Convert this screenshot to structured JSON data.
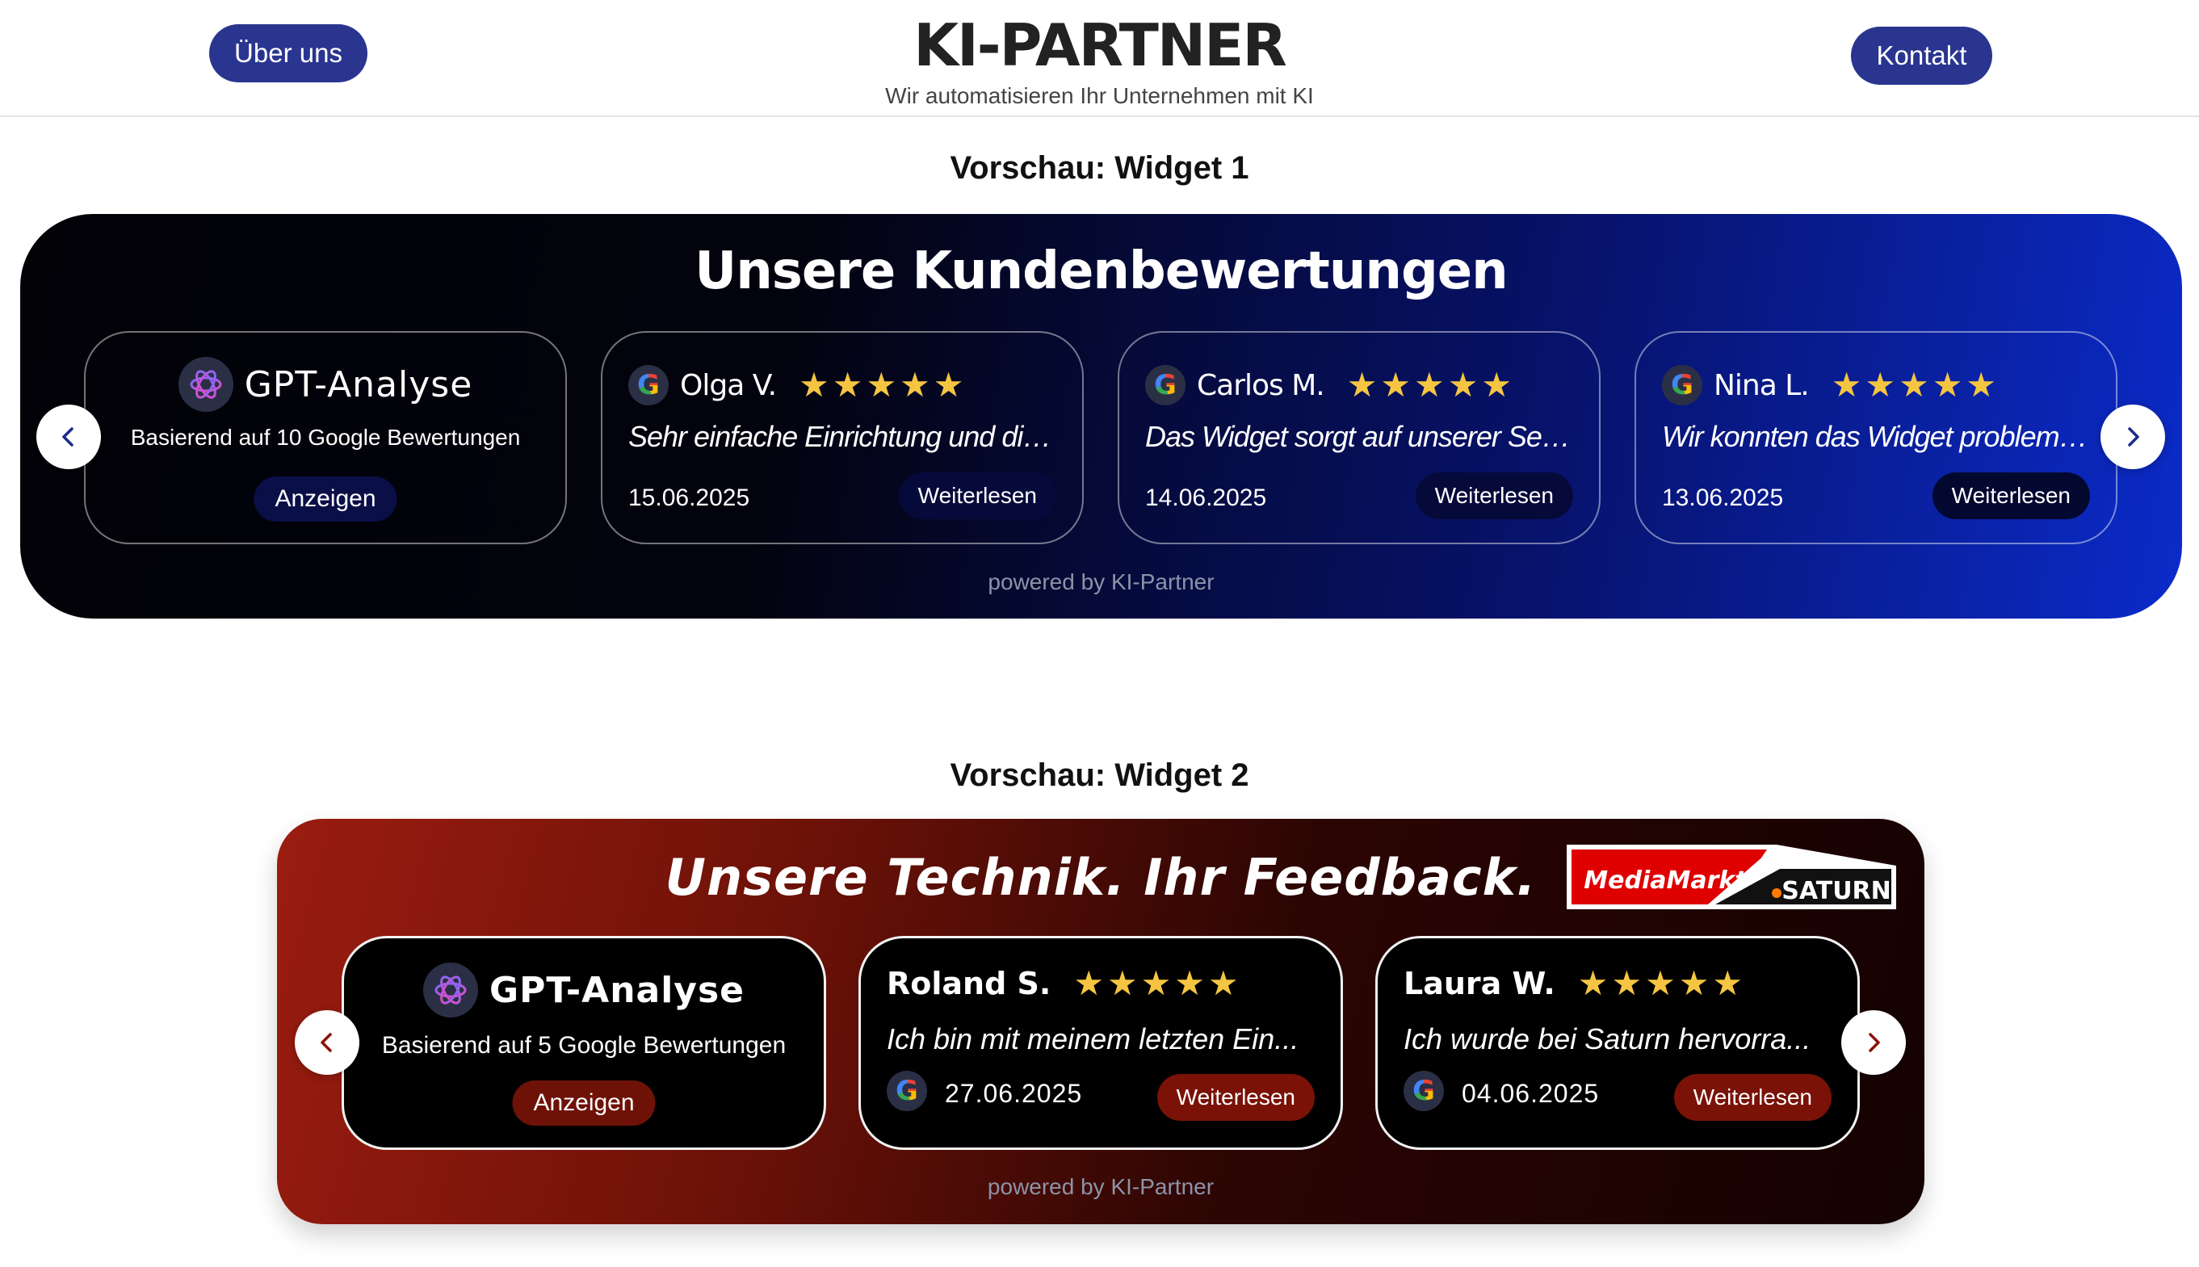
{
  "header": {
    "about_label": "Über uns",
    "logo_text": "KI-PARTNER",
    "tagline": "Wir automatisieren Ihr Unternehmen mit KI",
    "contact_label": "Kontakt"
  },
  "widget1": {
    "preview_label": "Vorschau: Widget 1",
    "title": "Unsere Kundenbewertungen",
    "gpt": {
      "title": "GPT-Analyse",
      "subtitle": "Basierend auf 10 Google Bewertungen",
      "button": "Anzeigen"
    },
    "reviews": [
      {
        "name": "Olga V.",
        "rating": 5,
        "text": "Sehr einfache Einrichtung und die ...",
        "date": "15.06.2025",
        "button": "Weiterlesen"
      },
      {
        "name": "Carlos M.",
        "rating": 5,
        "text": "Das Widget sorgt auf unserer Seite...",
        "date": "14.06.2025",
        "button": "Weiterlesen"
      },
      {
        "name": "Nina L.",
        "rating": 5,
        "text": "Wir konnten das Widget problemlo...",
        "date": "13.06.2025",
        "button": "Weiterlesen"
      }
    ],
    "powered_by": "powered by KI-Partner",
    "accent_color": "#0b2bc9"
  },
  "widget2": {
    "preview_label": "Vorschau: Widget 2",
    "title": "Unsere Technik. Ihr Feedback.",
    "brand_logo": {
      "left": "MediaMarkt",
      "right": "SATURN"
    },
    "gpt": {
      "title": "GPT-Analyse",
      "subtitle": "Basierend auf 5 Google Bewertungen",
      "button": "Anzeigen"
    },
    "reviews": [
      {
        "name": "Roland S.",
        "rating": 5,
        "text": "Ich bin mit meinem letzten Ein...",
        "date": "27.06.2025",
        "button": "Weiterlesen"
      },
      {
        "name": "Laura W.",
        "rating": 5,
        "text": "Ich wurde bei Saturn hervorra...",
        "date": "04.06.2025",
        "button": "Weiterlesen"
      }
    ],
    "powered_by": "powered by KI-Partner",
    "accent_color": "#7a1208"
  },
  "icons": {
    "star": "star-icon",
    "google": "google-icon",
    "gpt": "openai-icon",
    "prev": "chevron-left-icon",
    "next": "chevron-right-icon"
  }
}
